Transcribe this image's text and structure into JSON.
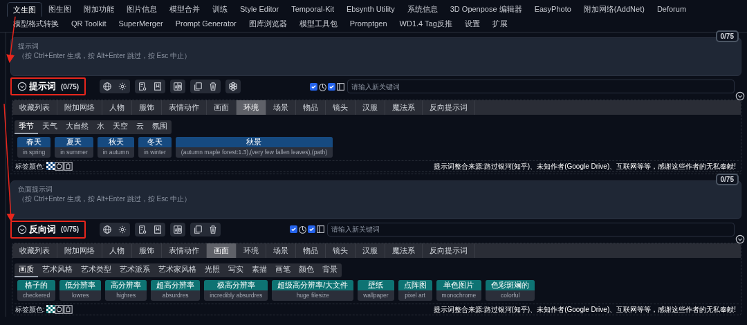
{
  "tab_rows": [
    {
      "tabs": [
        {
          "label": "文生图",
          "selected": true
        },
        {
          "label": "图生图",
          "selected": false
        },
        {
          "label": "附加功能",
          "selected": false
        },
        {
          "label": "图片信息",
          "selected": false
        },
        {
          "label": "模型合并",
          "selected": false
        },
        {
          "label": "训练",
          "selected": false
        },
        {
          "label": "Style Editor",
          "selected": false
        },
        {
          "label": "Temporal-Kit",
          "selected": false
        },
        {
          "label": "Ebsynth Utility",
          "selected": false
        },
        {
          "label": "系统信息",
          "selected": false
        },
        {
          "label": "3D Openpose 编辑器",
          "selected": false
        },
        {
          "label": "EasyPhoto",
          "selected": false
        },
        {
          "label": "附加网络(AddNet)",
          "selected": false
        },
        {
          "label": "Deforum",
          "selected": false
        }
      ]
    },
    {
      "tabs": [
        {
          "label": "模型格式转换",
          "selected": false
        },
        {
          "label": "QR Toolkit",
          "selected": false
        },
        {
          "label": "SuperMerger",
          "selected": false
        },
        {
          "label": "Prompt Generator",
          "selected": false
        },
        {
          "label": "图库浏览器",
          "selected": false
        },
        {
          "label": "模型工具包",
          "selected": false
        },
        {
          "label": "Promptgen",
          "selected": false
        },
        {
          "label": "WD1.4 Tag反推",
          "selected": false
        },
        {
          "label": "设置",
          "selected": false
        },
        {
          "label": "扩展",
          "selected": false
        }
      ]
    }
  ],
  "sections": [
    {
      "counter": "0/75",
      "placeholder": "提示词",
      "hint": "（按 Ctrl+Enter 生成，按 Alt+Enter 跳过，按 Esc 中止）",
      "title": "提示词",
      "title_count": "(0/75)",
      "highlighted": true,
      "ai_button": true,
      "options": [
        {
          "checked": true
        },
        {
          "checked": true
        }
      ],
      "keyword_placeholder": "请输入新关键词",
      "categories": [
        {
          "label": "收藏列表",
          "selected": false
        },
        {
          "label": "附加网络",
          "selected": false
        },
        {
          "label": "人物",
          "selected": false
        },
        {
          "label": "服饰",
          "selected": false
        },
        {
          "label": "表情动作",
          "selected": false
        },
        {
          "label": "画面",
          "selected": false
        },
        {
          "label": "环境",
          "selected": true
        },
        {
          "label": "场景",
          "selected": false
        },
        {
          "label": "物品",
          "selected": false
        },
        {
          "label": "镜头",
          "selected": false
        },
        {
          "label": "汉服",
          "selected": false
        },
        {
          "label": "魔法系",
          "selected": false
        },
        {
          "label": "反向提示词",
          "selected": false
        }
      ],
      "subcategories": [
        {
          "label": "季节",
          "selected": true
        },
        {
          "label": "天气",
          "selected": false
        },
        {
          "label": "大自然",
          "selected": false
        },
        {
          "label": "水",
          "selected": false
        },
        {
          "label": "天空",
          "selected": false
        },
        {
          "label": "云",
          "selected": false
        },
        {
          "label": "氛围",
          "selected": false
        }
      ],
      "color": "#164a80",
      "tags": [
        {
          "label": "春天",
          "english": "in spring"
        },
        {
          "label": "夏天",
          "english": "in summer"
        },
        {
          "label": "秋天",
          "english": "in autumn"
        },
        {
          "label": "冬天",
          "english": "in winter"
        },
        {
          "label": "秋景",
          "english": "(autumn maple forest:1.3),(very few fallen leaves),(path)"
        }
      ],
      "tag_color_label": "标签颜色:",
      "credit": "提示词整合来源:路过银河(知乎)、未知作者(Google Drive)、互联网等等，感谢这些作者的无私奉献!"
    },
    {
      "counter": "0/75",
      "placeholder": "负面提示词",
      "hint": "（按 Ctrl+Enter 生成，按 Alt+Enter 跳过，按 Esc 中止）",
      "title": "反向词",
      "title_count": "(0/75)",
      "highlighted": true,
      "ai_button": false,
      "options": [
        {
          "checked": true
        },
        {
          "checked": true
        }
      ],
      "keyword_placeholder": "请输入新关键词",
      "categories": [
        {
          "label": "收藏列表",
          "selected": false
        },
        {
          "label": "附加网络",
          "selected": false
        },
        {
          "label": "人物",
          "selected": false
        },
        {
          "label": "服饰",
          "selected": false
        },
        {
          "label": "表情动作",
          "selected": false
        },
        {
          "label": "画面",
          "selected": true
        },
        {
          "label": "环境",
          "selected": false
        },
        {
          "label": "场景",
          "selected": false
        },
        {
          "label": "物品",
          "selected": false
        },
        {
          "label": "镜头",
          "selected": false
        },
        {
          "label": "汉服",
          "selected": false
        },
        {
          "label": "魔法系",
          "selected": false
        },
        {
          "label": "反向提示词",
          "selected": false
        }
      ],
      "subcategories": [
        {
          "label": "画质",
          "selected": true
        },
        {
          "label": "艺术风格",
          "selected": false
        },
        {
          "label": "艺术类型",
          "selected": false
        },
        {
          "label": "艺术派系",
          "selected": false
        },
        {
          "label": "艺术家风格",
          "selected": false
        },
        {
          "label": "光照",
          "selected": false
        },
        {
          "label": "写实",
          "selected": false
        },
        {
          "label": "素描",
          "selected": false
        },
        {
          "label": "画笔",
          "selected": false
        },
        {
          "label": "颜色",
          "selected": false
        },
        {
          "label": "背景",
          "selected": false
        }
      ],
      "color": "#0e7373",
      "tags": [
        {
          "label": "格子的",
          "english": "checkered"
        },
        {
          "label": "低分辨率",
          "english": "lowres"
        },
        {
          "label": "高分辨率",
          "english": "highres"
        },
        {
          "label": "超高分辨率",
          "english": "absurdres"
        },
        {
          "label": "极高分辨率",
          "english": "incredibly absurdres"
        },
        {
          "label": "超级高分辨率/大文件",
          "english": "huge filesize"
        },
        {
          "label": "壁纸",
          "english": "wallpaper"
        },
        {
          "label": "点阵图",
          "english": "pixel art"
        },
        {
          "label": "单色图片",
          "english": "monochrome"
        },
        {
          "label": "色彩斑斓的",
          "english": "colorful"
        }
      ],
      "tag_color_label": "标签颜色:",
      "credit": "提示词整合来源:路过银河(知乎)、未知作者(Google Drive)、互联网等等，感谢这些作者的无私奉献!"
    }
  ]
}
